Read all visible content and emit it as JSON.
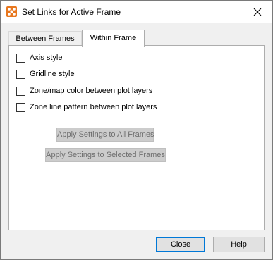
{
  "window": {
    "title": "Set Links for Active Frame",
    "app_icon": "tecplot-icon",
    "close_glyph": "close-icon"
  },
  "tabs": [
    {
      "label": "Between Frames",
      "selected": false
    },
    {
      "label": "Within Frame",
      "selected": true
    }
  ],
  "options": [
    {
      "label": "Axis style",
      "checked": false
    },
    {
      "label": "Gridline style",
      "checked": false
    },
    {
      "label": "Zone/map color between plot layers",
      "checked": false
    },
    {
      "label": "Zone line pattern between plot layers",
      "checked": false
    }
  ],
  "actions": {
    "apply_all": "Apply Settings to All Frames",
    "apply_selected": "Apply Settings to Selected Frames"
  },
  "footer": {
    "close_label": "Close",
    "help_label": "Help"
  },
  "colors": {
    "accent": "#0078d7",
    "icon_orange": "#e8771e"
  }
}
